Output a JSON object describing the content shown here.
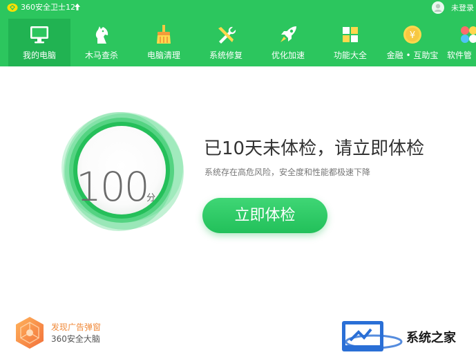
{
  "titlebar": {
    "app_title": "360安全卫士12",
    "upgrade_icon": "arrow-up-icon",
    "login_label": "未登录",
    "avatar_icon": "user-avatar-icon"
  },
  "nav": {
    "items": [
      {
        "label": "我的电脑",
        "icon": "monitor-icon",
        "active": true
      },
      {
        "label": "木马查杀",
        "icon": "horse-icon"
      },
      {
        "label": "电脑清理",
        "icon": "broom-icon"
      },
      {
        "label": "系统修复",
        "icon": "wrench-icon"
      },
      {
        "label": "优化加速",
        "icon": "rocket-icon"
      },
      {
        "label": "功能大全",
        "icon": "grid-icon"
      },
      {
        "label": "金融 • 互助宝",
        "icon": "yen-coin-icon"
      },
      {
        "label": "软件管",
        "icon": "software-icon"
      }
    ]
  },
  "score": {
    "value": "100",
    "unit": "分"
  },
  "status": {
    "headline": "已10天未体检，请立即体检",
    "subline": "系统存在高危风险，安全度和性能都极速下降",
    "check_button": "立即体检"
  },
  "notice": {
    "title": "发现广告弹窗",
    "subtitle": "360安全大脑",
    "icon": "brain-hexagon-icon"
  },
  "watermark": {
    "text": "系统之家"
  },
  "colors": {
    "brand_green": "#2cc65e",
    "nav_active": "#21b352",
    "notice_orange": "#f08a3b"
  }
}
